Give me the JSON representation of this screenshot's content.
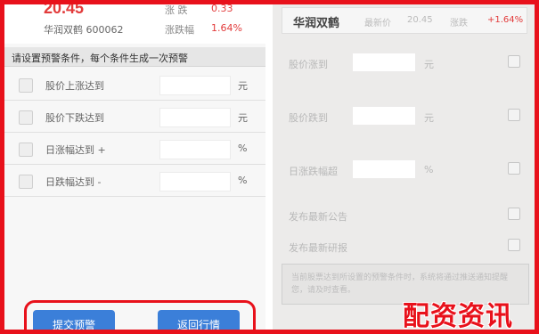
{
  "left": {
    "quote": {
      "price": "20.45",
      "change_label": "涨 跌",
      "change_value": "0.33",
      "stock_name": "华润双鹤 600062",
      "pct_label": "涨跌幅",
      "pct_value": "1.64%"
    },
    "header": "请设置预警条件，每个条件生成一次预警",
    "rows": [
      {
        "label": "股价上涨达到",
        "unit": "元"
      },
      {
        "label": "股价下跌达到",
        "unit": "元"
      },
      {
        "label": "日涨幅达到 +",
        "unit": "%"
      },
      {
        "label": "日跌幅达到 -",
        "unit": "%"
      }
    ],
    "buttons": {
      "left": "提交预警",
      "right": "返回行情"
    }
  },
  "right": {
    "quote": {
      "name": "华润双鹤",
      "sub1": "最新价",
      "sub2": "20.45",
      "sub3": "涨跌",
      "pct": "+1.64%"
    },
    "rows": [
      {
        "label": "股价涨到",
        "unit": "元"
      },
      {
        "label": "股价跌到",
        "unit": "元"
      },
      {
        "label": "日涨跌幅超",
        "unit": "%"
      },
      {
        "label": "发布最新公告",
        "unit": ""
      },
      {
        "label": "发布最新研报",
        "unit": ""
      }
    ],
    "note": "当前股票达到所设置的预警条件时，系统将通过推送通知提醒您，请及时查看。"
  },
  "watermark": "配资资讯",
  "colors": {
    "accent_red": "#e8111b",
    "button_blue": "#3b7fd9",
    "price_red": "#e23b3b"
  }
}
